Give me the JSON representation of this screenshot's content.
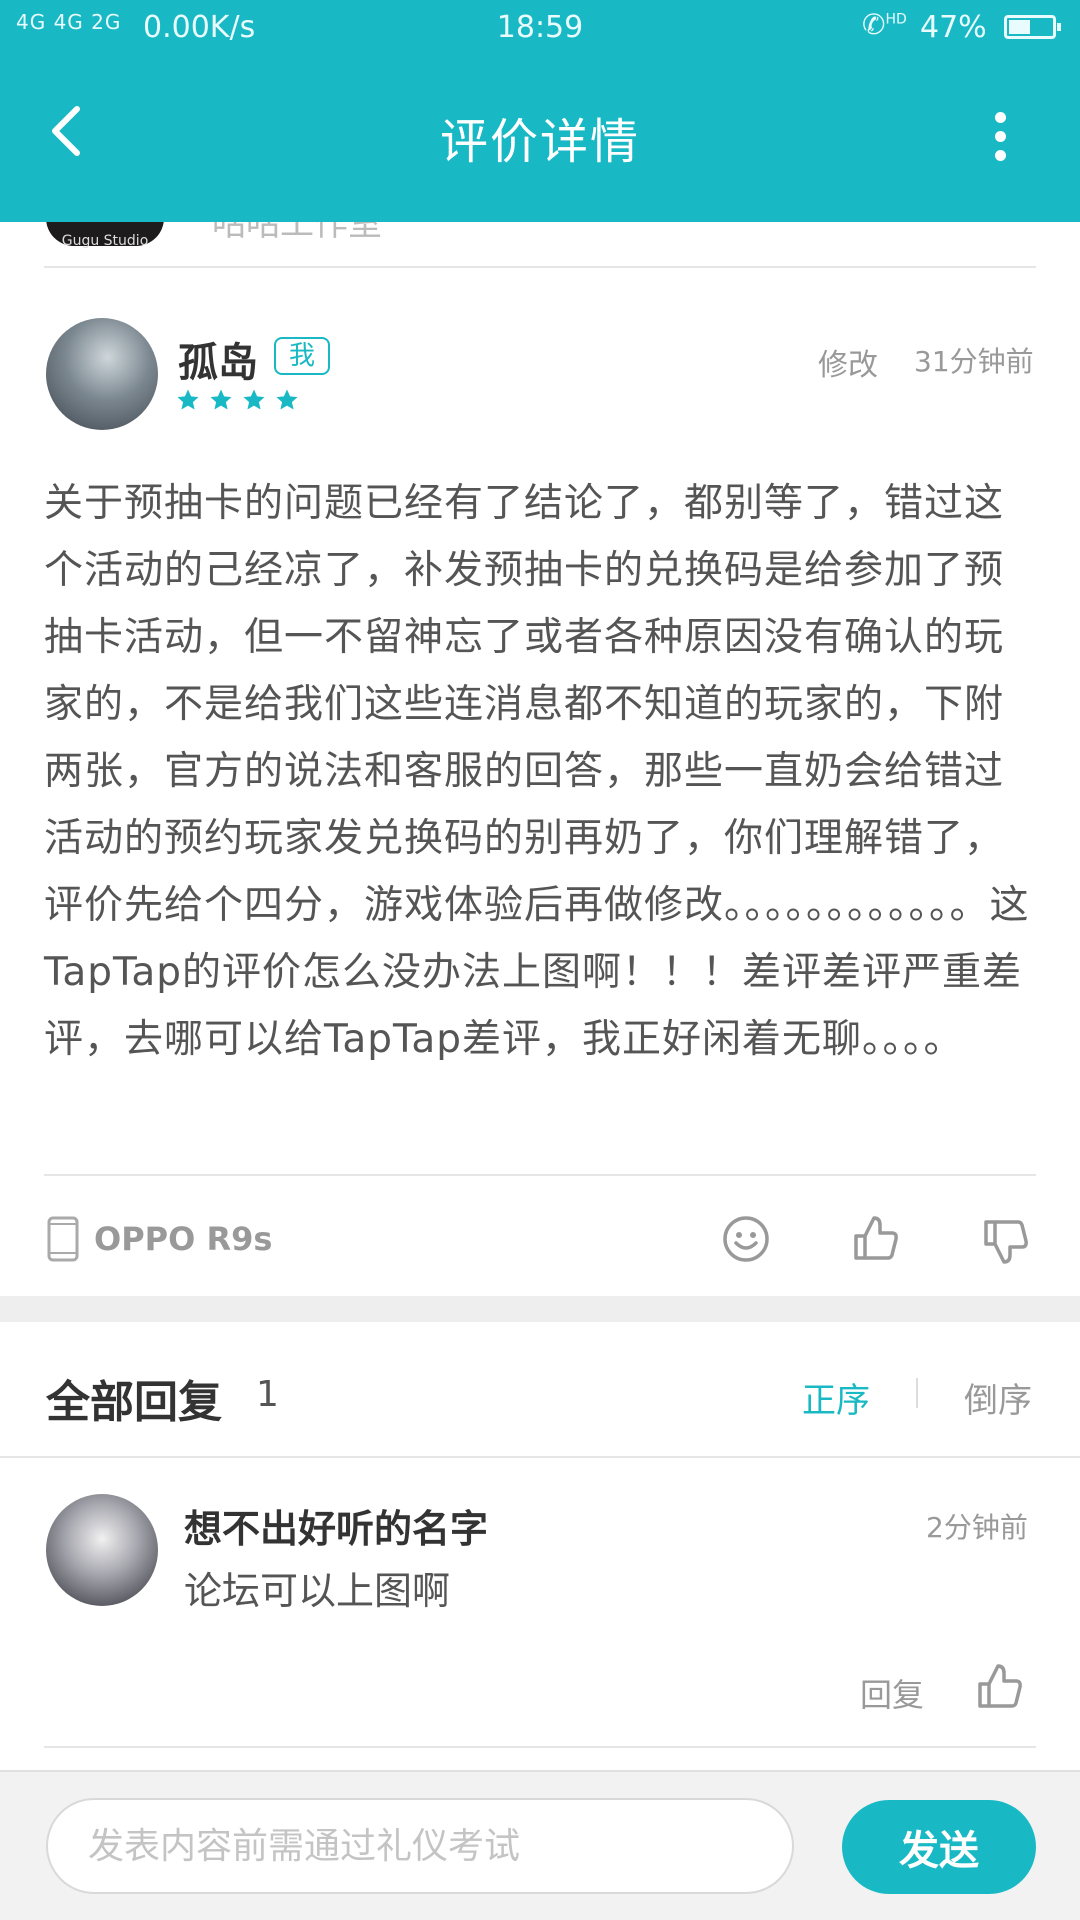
{
  "status_bar": {
    "signal": "4G 4G 2G",
    "network_speed": "0.00K/s",
    "time": "18:59",
    "call_indicator": "HD",
    "battery_percent": "47%",
    "battery_level": 0.47
  },
  "header": {
    "title": "评价详情",
    "back_icon": "chevron-left-icon",
    "more_icon": "more-vertical-icon"
  },
  "developer_peek": {
    "logo_text": "Gugu Studio",
    "studio_name": "咕咕工作室"
  },
  "review": {
    "author": "孤岛",
    "badge": "我",
    "rating": 4,
    "edit_label": "修改",
    "time": "31分钟前",
    "body": "关于预抽卡的问题已经有了结论了，都别等了，错过这个活动的己经凉了，补发预抽卡的兑换码是给参加了预抽卡活动，但一不留神忘了或者各种原因没有确认的玩家的，不是给我们这些连消息都不知道的玩家的，下附两张，官方的说法和客服的回答，那些一直奶会给错过活动的预约玩家发兑换码的别再奶了，你们理解错了，评价先给个四分，游戏体验后再做修改。。。。。。。。。。。。这TapTap的评价怎么没办法上图啊！！！差评差评严重差评，去哪可以给TapTap差评，我正好闲着无聊。。。。",
    "device": "OPPO R9s",
    "accent_color": "#18b9c5"
  },
  "replies": {
    "title": "全部回复",
    "count": "1",
    "sort_asc": "正序",
    "sort_desc": "倒序",
    "items": [
      {
        "name": "想不出好听的名字",
        "time": "2分钟前",
        "text": "论坛可以上图啊",
        "reply_label": "回复"
      }
    ]
  },
  "compose": {
    "placeholder": "发表内容前需通过礼仪考试",
    "send_label": "发送"
  }
}
